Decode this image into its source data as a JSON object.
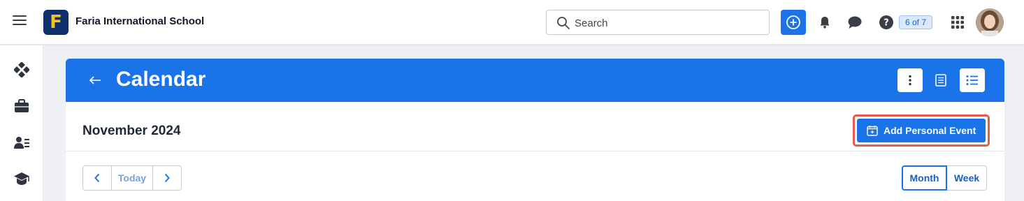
{
  "topbar": {
    "school_name": "Faria International School",
    "logo_letter": "F",
    "search_placeholder": "Search",
    "pager": "6 of 7",
    "icons": [
      "menu-icon",
      "plus-circle-icon",
      "bell-icon",
      "chat-bubble-icon",
      "help-icon",
      "apps-grid-icon"
    ]
  },
  "sidebar": {
    "items": [
      "diamond-grid-icon",
      "briefcase-icon",
      "person-list-icon",
      "graduation-cap-icon"
    ]
  },
  "page": {
    "title": "Calendar",
    "month": "November 2024",
    "add_event_label": "Add Personal Event",
    "today_label": "Today",
    "views": {
      "month": "Month",
      "week": "Week"
    },
    "selected_view": "Month"
  },
  "colors": {
    "brand_blue": "#1a73e8",
    "logo_navy": "#0d2f6b",
    "logo_yellow": "#f6c31c",
    "highlight_red": "#e95a4e"
  }
}
